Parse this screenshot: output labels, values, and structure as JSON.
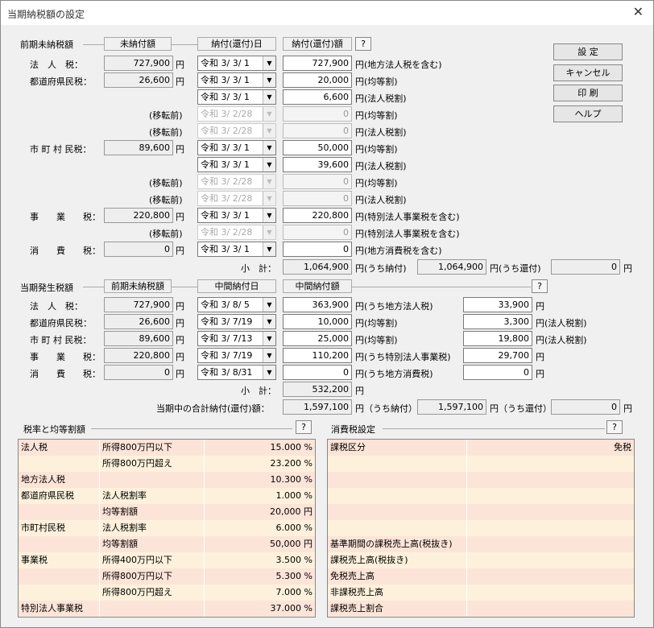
{
  "window": {
    "title": "当期納税額の設定",
    "close": "✕"
  },
  "buttons": {
    "set": "設 定",
    "cancel": "キャンセル",
    "print": "印 刷",
    "help": "ヘルプ",
    "q": "?"
  },
  "unpaid": {
    "section_label": "前期未納税額",
    "col_unpaid": "未納付額",
    "col_date": "納付(還付)日",
    "col_amount": "納付(還付)額",
    "rows": [
      {
        "label": "法　人　税：",
        "unpaid": "727,900",
        "date": "令和 3/ 3/ 1",
        "amount": "727,900",
        "note": "円(地方法人税を含む)",
        "yen": "円"
      },
      {
        "label": "都道府県民税：",
        "unpaid": "26,600",
        "date": "令和 3/ 3/ 1",
        "amount": "20,000",
        "note": "円(均等割)",
        "yen": "円"
      },
      {
        "label": "",
        "unpaid": "",
        "date": "令和 3/ 3/ 1",
        "amount": "6,600",
        "note": "円(法人税割)"
      },
      {
        "label": "(移転前)",
        "date": "令和 3/ 2/28",
        "amount": "0",
        "note": "円(均等割)",
        "dis": true
      },
      {
        "label": "(移転前)",
        "date": "令和 3/ 2/28",
        "amount": "0",
        "note": "円(法人税割)",
        "dis": true
      },
      {
        "label": "市 町 村 民税：",
        "unpaid": "89,600",
        "date": "令和 3/ 3/ 1",
        "amount": "50,000",
        "note": "円(均等割)",
        "yen": "円"
      },
      {
        "label": "",
        "date": "令和 3/ 3/ 1",
        "amount": "39,600",
        "note": "円(法人税割)"
      },
      {
        "label": "(移転前)",
        "date": "令和 3/ 2/28",
        "amount": "0",
        "note": "円(均等割)",
        "dis": true
      },
      {
        "label": "(移転前)",
        "date": "令和 3/ 2/28",
        "amount": "0",
        "note": "円(法人税割)",
        "dis": true
      },
      {
        "label": "事　　業　　税：",
        "unpaid": "220,800",
        "date": "令和 3/ 3/ 1",
        "amount": "220,800",
        "note": "円(特別法人事業税を含む)",
        "yen": "円"
      },
      {
        "label": "(移転前)",
        "date": "令和 3/ 2/28",
        "amount": "0",
        "note": "円(特別法人事業税を含む)",
        "dis": true
      },
      {
        "label": "消　　費　　税：",
        "unpaid": "0",
        "date": "令和 3/ 3/ 1",
        "amount": "0",
        "note": "円(地方消費税を含む)",
        "yen": "円"
      }
    ],
    "subtotal_label": "小　計：",
    "subtotal": "1,064,900",
    "paid_label": "円(うち納付)",
    "paid": "1,064,900",
    "refund_label": "円(うち還付)",
    "refund": "0",
    "yen": "円"
  },
  "interim": {
    "section_label": "当期発生税額",
    "col_prev": "前期未納税額",
    "col_date": "中間納付日",
    "col_amount": "中間納付額",
    "rows": [
      {
        "label": "法　人　税：",
        "prev": "727,900",
        "date": "令和 3/ 8/ 5",
        "amount": "363,900",
        "note": "円(うち地方法人税)",
        "extra": "33,900",
        "extra_note": "円"
      },
      {
        "label": "都道府県民税：",
        "prev": "26,600",
        "date": "令和 3/ 7/19",
        "amount": "10,000",
        "note": "円(均等割)",
        "extra": "3,300",
        "extra_note": "円(法人税割)"
      },
      {
        "label": "市 町 村 民税：",
        "prev": "89,600",
        "date": "令和 3/ 7/13",
        "amount": "25,000",
        "note": "円(均等割)",
        "extra": "19,800",
        "extra_note": "円(法人税割)"
      },
      {
        "label": "事　　業　　税：",
        "prev": "220,800",
        "date": "令和 3/ 7/19",
        "amount": "110,200",
        "note": "円(うち特別法人事業税)",
        "extra": "29,700",
        "extra_note": "円"
      },
      {
        "label": "消　　費　　税：",
        "prev": "0",
        "date": "令和 3/ 8/31",
        "amount": "0",
        "note": "円(うち地方消費税)",
        "extra": "0",
        "extra_note": "円"
      }
    ],
    "yen": "円",
    "subtotal_label": "小　計：",
    "subtotal": "532,200",
    "total_label": "当期中の合計納付(還付)額：",
    "total": "1,597,100",
    "paid_label": "円（うち納付）",
    "paid": "1,597,100",
    "refund_label": "円（うち還付）",
    "refund": "0"
  },
  "rates": {
    "title": "税率と均等割額",
    "rows": [
      {
        "a": "法人税",
        "b": "所得800万円以下",
        "c": "15.000 %"
      },
      {
        "a": "",
        "b": "所得800万円超え",
        "c": "23.200 %"
      },
      {
        "a": "地方法人税",
        "b": "",
        "c": "10.300 %"
      },
      {
        "a": "都道府県民税",
        "b": "法人税割率",
        "c": "1.000 %"
      },
      {
        "a": "",
        "b": "均等割額",
        "c": "20,000 円"
      },
      {
        "a": "市町村民税",
        "b": "法人税割率",
        "c": "6.000 %"
      },
      {
        "a": "",
        "b": "均等割額",
        "c": "50,000 円"
      },
      {
        "a": "事業税",
        "b": "所得400万円以下",
        "c": "3.500 %"
      },
      {
        "a": "",
        "b": "所得800万円以下",
        "c": "5.300 %"
      },
      {
        "a": "",
        "b": "所得800万円超え",
        "c": "7.000 %"
      },
      {
        "a": "特別法人事業税",
        "b": "",
        "c": "37.000 %"
      }
    ]
  },
  "consumption": {
    "title": "消費税設定",
    "rows": [
      {
        "a": "課税区分",
        "c": "免税"
      },
      {
        "a": "",
        "c": ""
      },
      {
        "a": "",
        "c": ""
      },
      {
        "a": "",
        "c": ""
      },
      {
        "a": "",
        "c": ""
      },
      {
        "a": "",
        "c": ""
      },
      {
        "a": "基準期間の課税売上高(税抜き)",
        "c": ""
      },
      {
        "a": "課税売上高(税抜き)",
        "c": ""
      },
      {
        "a": "免税売上高",
        "c": ""
      },
      {
        "a": "非課税売上高",
        "c": ""
      },
      {
        "a": "課税売上割合",
        "c": ""
      }
    ]
  },
  "colors": {
    "row_a": "#fde4d8",
    "row_b": "#fdf1dc"
  }
}
